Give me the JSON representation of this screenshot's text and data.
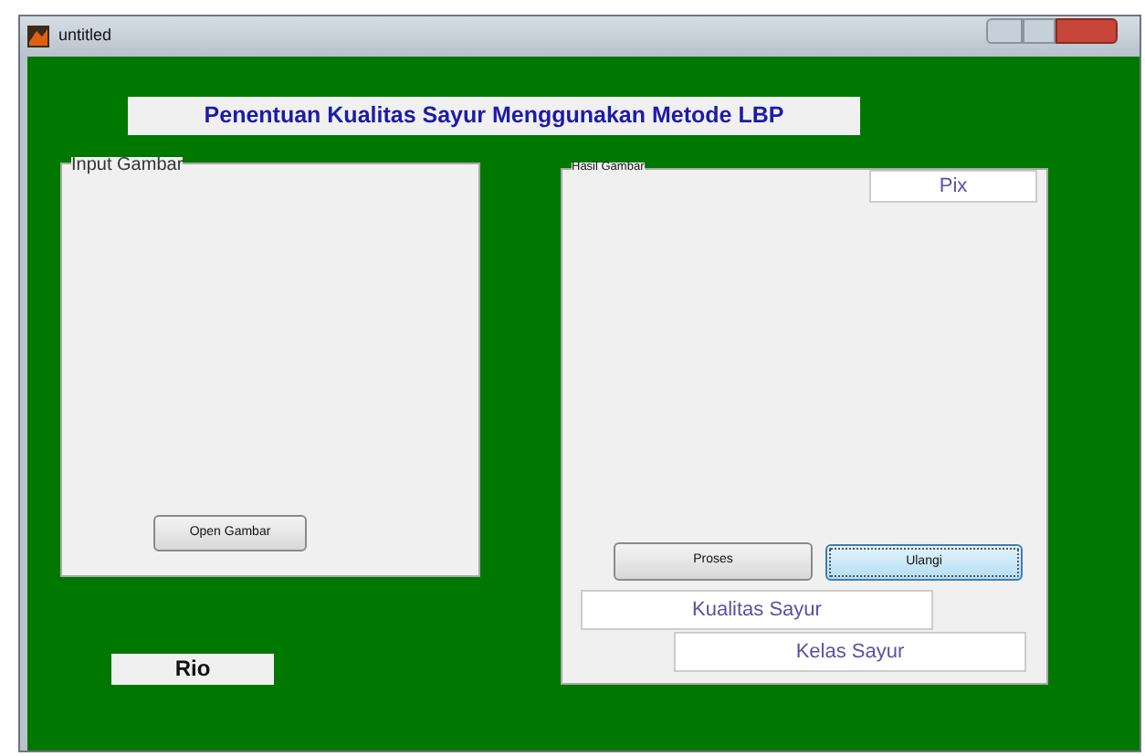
{
  "window": {
    "title": "untitled"
  },
  "heading": "Penentuan Kualitas Sayur Menggunakan Metode LBP",
  "panels": [
    {
      "title": "Input Gambar",
      "kind": "input"
    },
    {
      "title": "Hasil Gambar",
      "kind": "result"
    }
  ],
  "buttons": [
    {
      "label": "Open Gambar",
      "focused": false
    },
    {
      "label": "Proses",
      "focused": false
    },
    {
      "label": "Ulangi",
      "focused": true
    }
  ],
  "texts": {
    "name": "Rio",
    "pix": "Pix",
    "quality": "Kualitas Sayur",
    "class": "Kelas Sayur"
  }
}
